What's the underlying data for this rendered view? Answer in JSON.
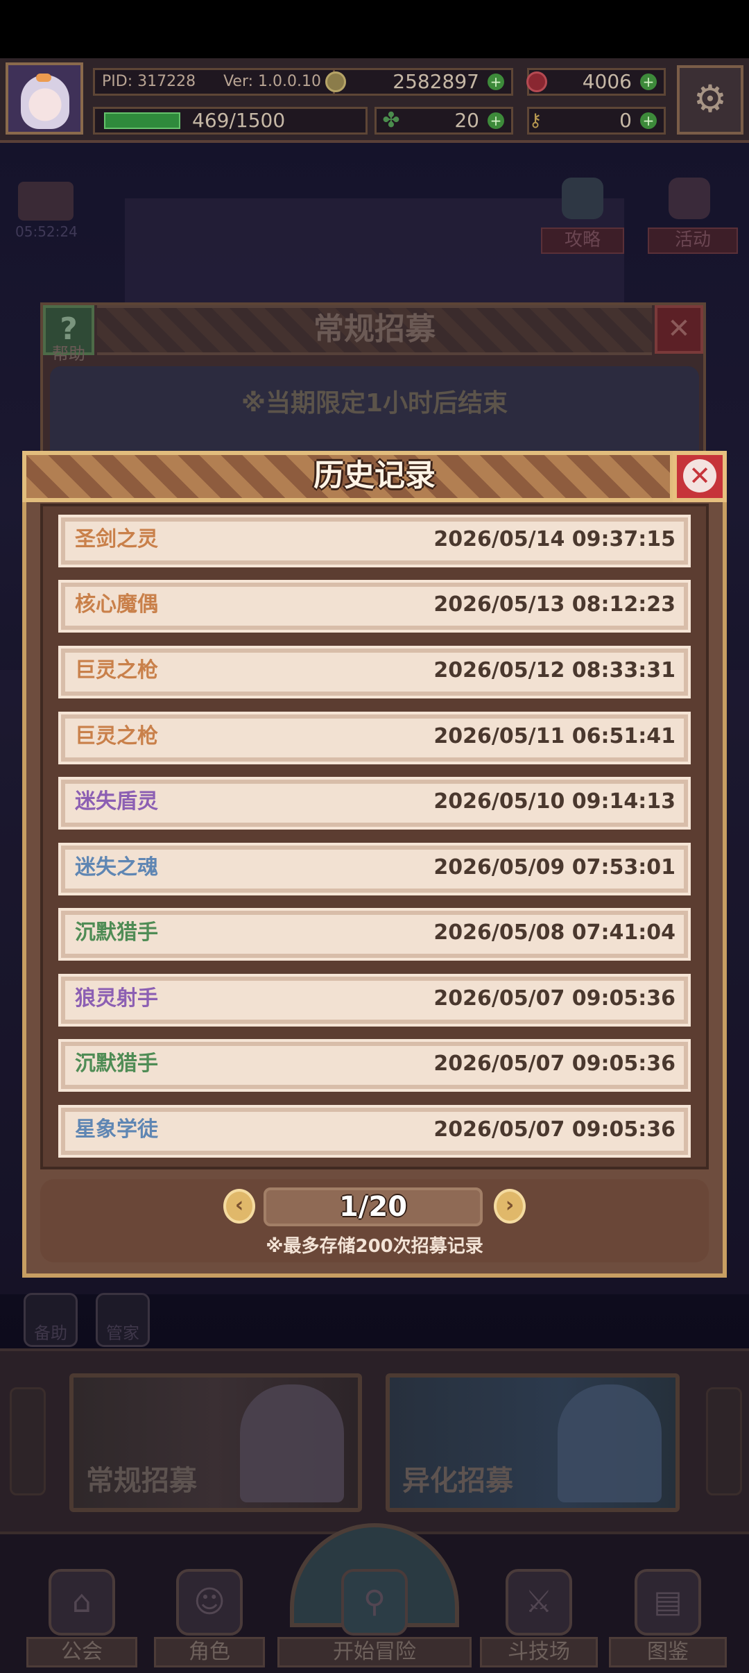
{
  "hud": {
    "pid": "PID: 317228",
    "version": "Ver: 1.0.0.10",
    "coins": "2582897",
    "gems": "4006",
    "energy": "469/1500",
    "energy_fraction": 0.313,
    "clovers": "20",
    "keys": "0"
  },
  "background": {
    "timer": "05:52:24",
    "strategy_label": "攻略",
    "activity_label": "活动",
    "recruit_title": "常规招募",
    "help_label": "帮助",
    "recruit_notice": "※当期限定1小时后结束"
  },
  "history": {
    "title": "历史记录",
    "records": [
      {
        "name": "圣剑之灵",
        "time": "2026/05/14 09:37:15",
        "color": "#c9804a"
      },
      {
        "name": "核心魔偶",
        "time": "2026/05/13 08:12:23",
        "color": "#c9804a"
      },
      {
        "name": "巨灵之枪",
        "time": "2026/05/12 08:33:31",
        "color": "#c9804a"
      },
      {
        "name": "巨灵之枪",
        "time": "2026/05/11 06:51:41",
        "color": "#c9804a"
      },
      {
        "name": "迷失盾灵",
        "time": "2026/05/10 09:14:13",
        "color": "#8c5fb3"
      },
      {
        "name": "迷失之魂",
        "time": "2026/05/09 07:53:01",
        "color": "#5f86b3"
      },
      {
        "name": "沉默猎手",
        "time": "2026/05/08 07:41:04",
        "color": "#4f8c55"
      },
      {
        "name": "狼灵射手",
        "time": "2026/05/07 09:05:36",
        "color": "#8c5fb3"
      },
      {
        "name": "沉默猎手",
        "time": "2026/05/07 09:05:36",
        "color": "#4f8c55"
      },
      {
        "name": "星象学徒",
        "time": "2026/05/07 09:05:36",
        "color": "#5f86b3"
      }
    ],
    "page": "1/20",
    "note": "※最多存储200次招募记录"
  },
  "tools": {
    "tool1_label": "备助",
    "tool2_label": "管家"
  },
  "recruit_tabs": {
    "normal": "常规招募",
    "alien": "异化招募"
  },
  "nav": {
    "guild": "公会",
    "role": "角色",
    "adventure": "开始冒险",
    "arena": "斗技场",
    "codex": "图鉴"
  }
}
